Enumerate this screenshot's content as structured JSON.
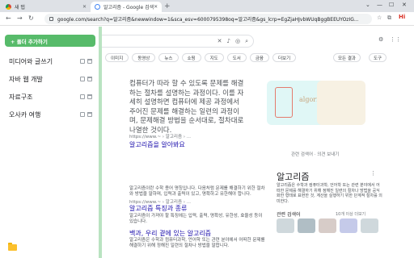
{
  "browser": {
    "tabs": [
      {
        "title": "새 탭",
        "active": false
      },
      {
        "title": "알고리즘 - Google 검색",
        "active": true
      }
    ],
    "new_tab": "+",
    "window_controls": [
      "⌄",
      "—",
      "☐",
      "✕"
    ],
    "address": "google.com/search?q=알고리즘&newwindow=1&sca_esv=6000795398oq=알고리즘&gs_lcrp=EgZjaHJvbWUqBggBEEUYOzIG...",
    "profile_label": "Hi"
  },
  "google": {
    "filters": [
      "이미지",
      "동영상",
      "뉴스",
      "쇼핑",
      "지도",
      "도서",
      "금융",
      "더보기"
    ],
    "tools": [
      "모든 결과",
      "도구"
    ],
    "snippet": "컴퓨터가 따라 할 수 있도록 문제를 해결하는 절차를 설명하는 과정이다. 이를 자세히 설명하면 컴퓨터에 제공 과정에서 주어진 문제를 해결하는 일련의 과정이며, 문제해결 방법을 순서대로, 절차대로 나열한 것이다.",
    "snippet_link": "알고리즘을 알아봐요",
    "thumb_word": "algorithm",
    "result1_meta": "https://www.~ › 알고리즘 › ...",
    "result1_text": "알고리즘이란 수학 용어 명칭입니다. 다음처럼 문제를 해결하기 위한 절차와 방법을 말하며, 입력과 출력이 있고, 명확하고 유한해야 합니다.",
    "result2_meta": "https://www.~ › 알고리즘 › ...",
    "result2_title": "알고리즘 특징과 종류",
    "result2_text": "알고리즘이 가져야 할 특징에는 입력, 출력, 명확성, 유한성, 효율성 등이 있습니다.",
    "result3_title": "백과, 우리 곁에 있는 알고리즘",
    "result3_text": "알고리즘은 수학과 컴퓨터과학, 언어학 또는 관련 분야에서 어떠한 문제를 해결하기 위해 정해진 일련의 절차나 방법을 말합니다.",
    "feedback": "관련 검색어 · 의견 보내기",
    "kp_title": "알고리즘",
    "kp_more": "⋮",
    "kp_text": "알고리즘은 수학과 컴퓨터과학, 언어학 또는 관련 분야에서 어떠한 문제를 해결하기 위해 정해진 일련의 절차나 방법을 공식화한 형태로 표현한 것, 계산을 실행하기 위한 단계적 절차를 의미한다.",
    "kp_related": "관련 검색어",
    "kp_related_more": "10개 이상 더보기"
  },
  "panel": {
    "add_button": "+ 폴더 추가하기",
    "folders": [
      "미디어와 글쓰기",
      "자바 웹 개발",
      "자료구조",
      "오사카 여행"
    ]
  },
  "colors": {
    "accent_green": "#57bb6a",
    "edge_green": "#b9e3c1",
    "link_blue": "#1a0dab",
    "folder_yellow": "#fbc02d"
  }
}
